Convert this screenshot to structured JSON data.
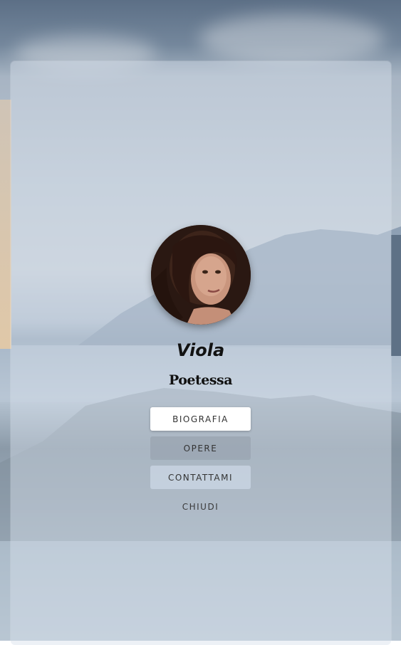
{
  "profile": {
    "name": "Viola",
    "role": "Poetessa"
  },
  "menu": {
    "biografia": "BIOGRAFIA",
    "opere": "OPERE",
    "contattami": "CONTATTAMI",
    "chiudi": "CHIUDI"
  },
  "colors": {
    "card_overlay": "#d6e0ec",
    "button_active": "#ffffff",
    "button_opere": "#96a2ae",
    "button_contatti": "#c8d4e2"
  }
}
